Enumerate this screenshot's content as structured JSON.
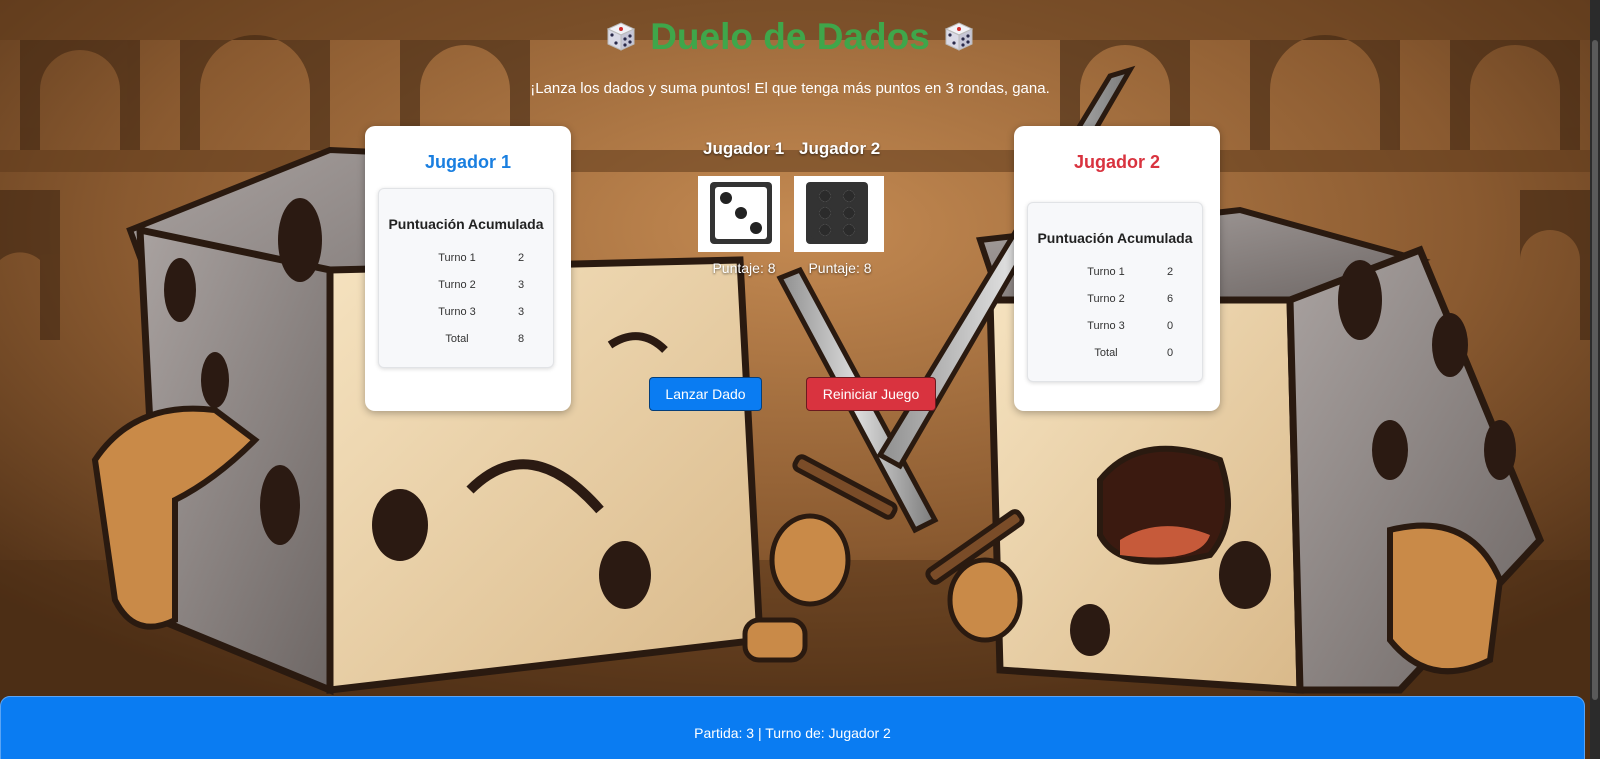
{
  "header": {
    "title": "Duelo de Dados",
    "subtitle": "¡Lanza los dados y suma puntos! El que tenga más puntos en 3 rondas, gana.",
    "title_color": "#3fa64a"
  },
  "player1": {
    "name": "Jugador 1",
    "name_color": "#1a7fe0",
    "score_title": "Puntuación Acumulada",
    "rows": [
      {
        "label": "Turno 1",
        "value": "2"
      },
      {
        "label": "Turno 2",
        "value": "3"
      },
      {
        "label": "Turno 3",
        "value": "3"
      },
      {
        "label": "Total",
        "value": "8"
      }
    ]
  },
  "player2": {
    "name": "Jugador 2",
    "name_color": "#d9333f",
    "score_title": "Puntuación Acumulada",
    "rows": [
      {
        "label": "Turno 1",
        "value": "2"
      },
      {
        "label": "Turno 2",
        "value": "6"
      },
      {
        "label": "Turno 3",
        "value": "0"
      },
      {
        "label": "Total",
        "value": "0"
      }
    ]
  },
  "dice": {
    "p1_label": "Jugador 1",
    "p2_label": "Jugador 2",
    "p1_face": 3,
    "p2_face": 6,
    "p1_score": "Puntaje: 8",
    "p2_score": "Puntaje: 8"
  },
  "buttons": {
    "roll": "Lanzar Dado",
    "reset": "Reiniciar Juego",
    "roll_color": "#0a7cf2",
    "reset_color": "#d9333f"
  },
  "footer": {
    "status": "Partida: 3 | Turno de: Jugador 2",
    "color": "#0a7cf2"
  }
}
